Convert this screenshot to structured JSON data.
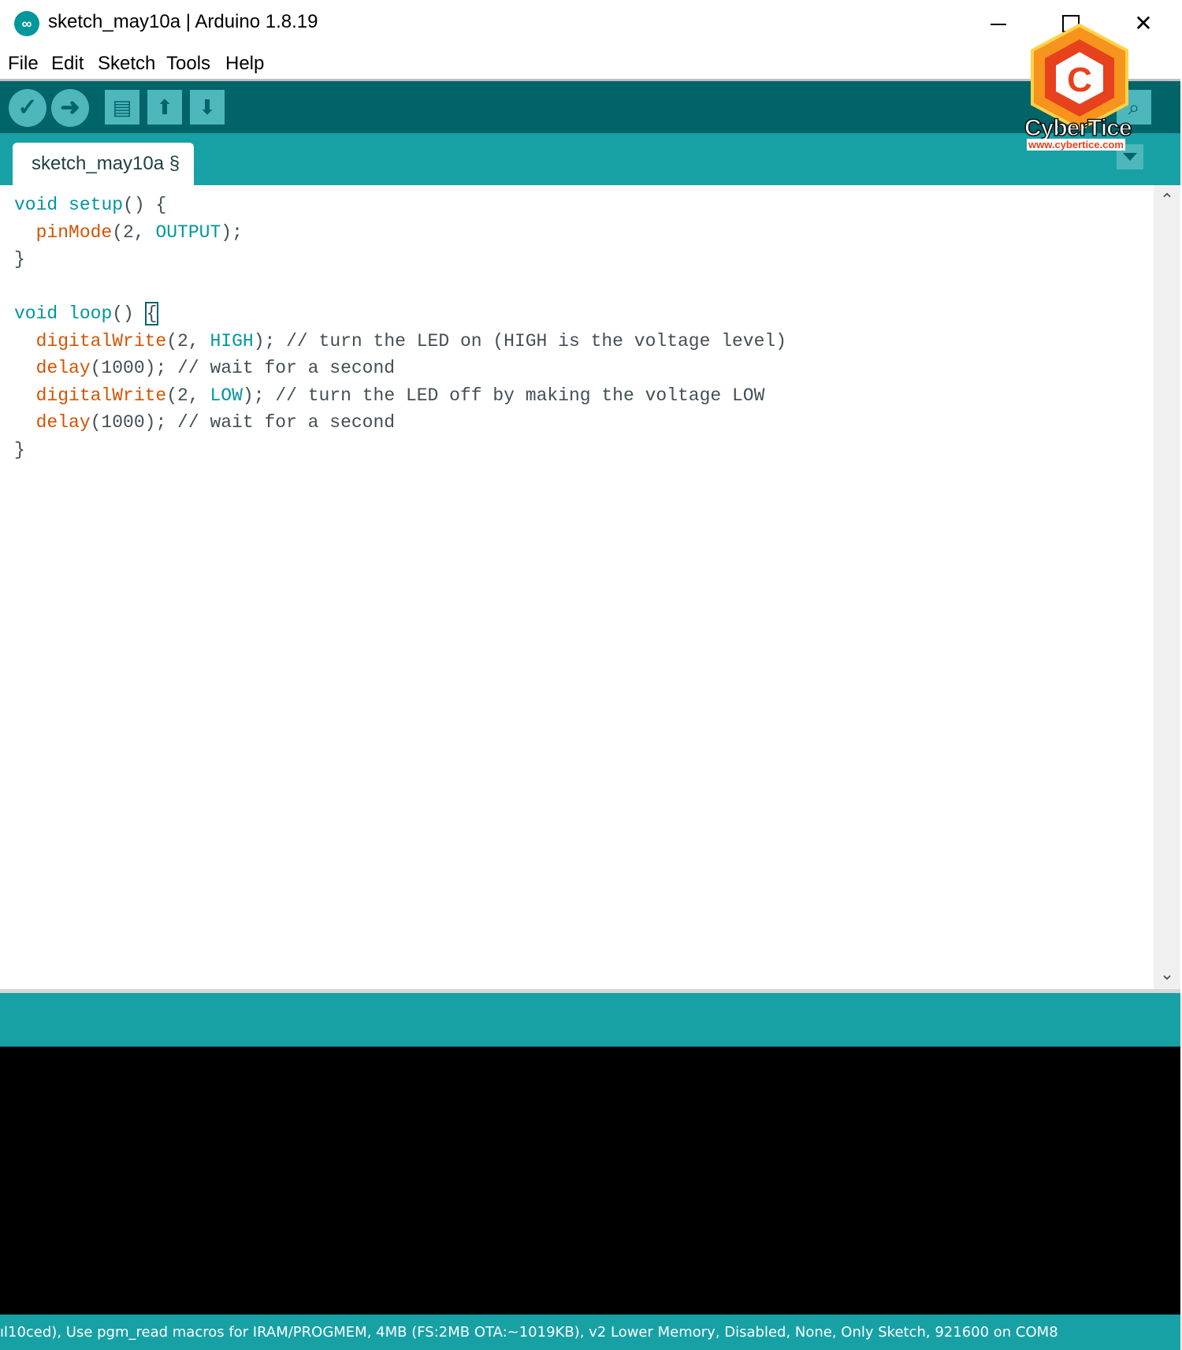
{
  "window": {
    "title": "sketch_may10a | Arduino 1.8.19",
    "icon": "arduino-logo-icon"
  },
  "menu": [
    "File",
    "Edit",
    "Sketch",
    "Tools",
    "Help"
  ],
  "toolbar": {
    "buttons": [
      "verify-icon",
      "upload-icon",
      "new-icon",
      "open-icon",
      "save-icon"
    ],
    "right_button": "serial-monitor-icon"
  },
  "tab": {
    "label": "sketch_may10a §"
  },
  "code": {
    "lines": [
      "void setup() {",
      "  pinMode(2, OUTPUT);",
      "}",
      "",
      "void loop() {",
      "  digitalWrite(2, HIGH); // turn the LED on (HIGH is the voltage level)",
      "  delay(1000); // wait for a second",
      "  digitalWrite(2, LOW); // turn the LED off by making the voltage LOW",
      "  delay(1000); // wait for a second",
      "}"
    ]
  },
  "status": {
    "text": "ıl10ced), Use pgm_read macros for IRAM/PROGMEM, 4MB (FS:2MB OTA:~1019KB), v2 Lower Memory, Disabled, None, Only Sketch, 921600 on COM8"
  },
  "watermark": {
    "brand": "CyberTice",
    "url": "www.cybertice.com"
  },
  "colors": {
    "toolbar": "#006468",
    "tabbar": "#17a1a5",
    "keyword": "#00979c",
    "function": "#d35400",
    "console": "#000000"
  }
}
